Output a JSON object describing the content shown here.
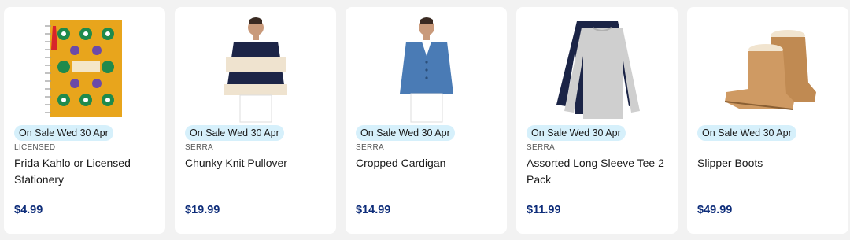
{
  "products": [
    {
      "image": "notebook-image",
      "badge": "On Sale Wed 30 Apr",
      "brand": "LICENSED",
      "title": "Frida Kahlo or Licensed Stationery",
      "price": "$4.99"
    },
    {
      "image": "pullover-image",
      "badge": "On Sale Wed 30 Apr",
      "brand": "SERRA",
      "title": "Chunky Knit Pullover",
      "price": "$19.99"
    },
    {
      "image": "cardigan-image",
      "badge": "On Sale Wed 30 Apr",
      "brand": "SERRA",
      "title": "Cropped Cardigan",
      "price": "$14.99"
    },
    {
      "image": "tee-pack-image",
      "badge": "On Sale Wed 30 Apr",
      "brand": "SERRA",
      "title": "Assorted Long Sleeve Tee 2 Pack",
      "price": "$11.99"
    },
    {
      "image": "boots-image",
      "badge": "On Sale Wed 30 Apr",
      "brand": "",
      "title": "Slipper Boots",
      "price": "$49.99"
    }
  ],
  "colors": {
    "page_bg": "#f2f2f2",
    "card_bg": "#ffffff",
    "badge_bg": "#d6f0fb",
    "price": "#0e2d7a"
  }
}
